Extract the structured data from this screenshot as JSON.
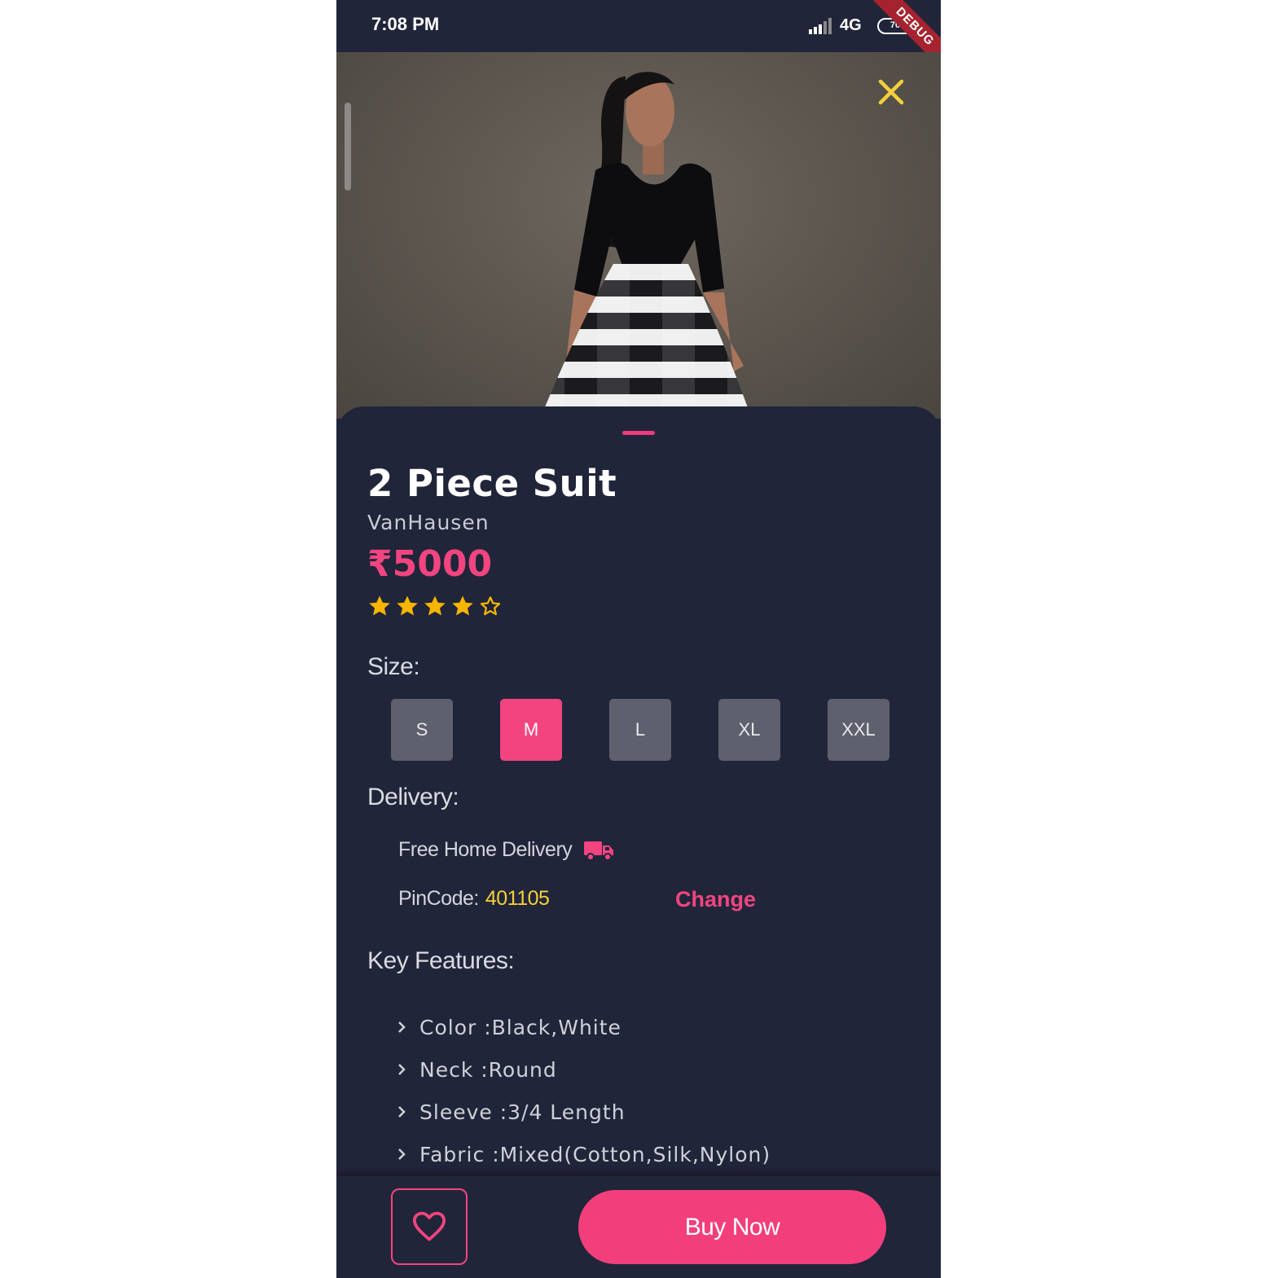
{
  "status_bar": {
    "time": "7:08 PM",
    "network": "4G",
    "battery": "70",
    "debug_label": "DEBUG"
  },
  "product": {
    "title": "2 Piece Suit",
    "brand": "VanHausen",
    "price": "₹5000",
    "rating": 4,
    "rating_max": 5
  },
  "size": {
    "label": "Size:",
    "options": [
      "S",
      "M",
      "L",
      "XL",
      "XXL"
    ],
    "selected": "M"
  },
  "delivery": {
    "label": "Delivery:",
    "free_text": "Free Home Delivery",
    "pincode_label": "PinCode:",
    "pincode_value": "401105",
    "change_label": "Change"
  },
  "features": {
    "label": "Key Features:",
    "items": [
      "Color :Black,White",
      "Neck :Round",
      "Sleeve :3/4 Length",
      "Fabric :Mixed(Cotton,Silk,Nylon)"
    ]
  },
  "actions": {
    "buy_label": "Buy Now"
  },
  "colors": {
    "accent": "#f2457f",
    "background": "#21253a",
    "star": "#f7b500",
    "pincode": "#f4cf3b",
    "close_icon": "#f4cf3b"
  }
}
